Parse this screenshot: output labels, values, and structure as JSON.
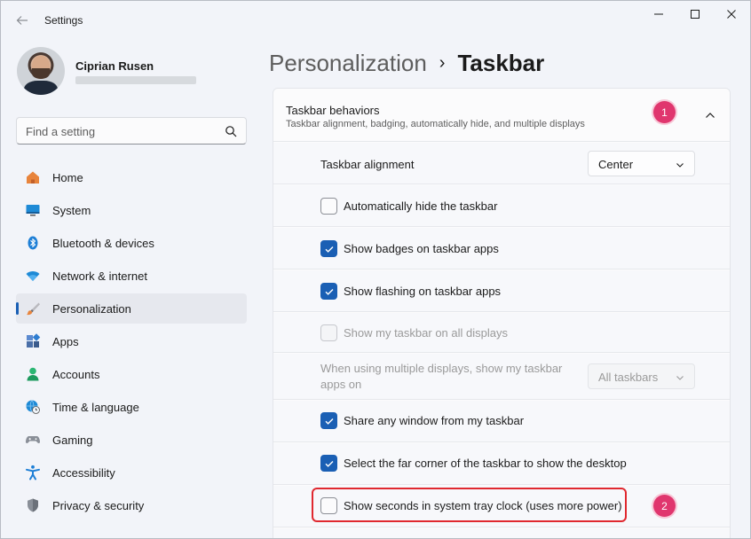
{
  "window": {
    "title": "Settings"
  },
  "user": {
    "name": "Ciprian Rusen"
  },
  "search": {
    "placeholder": "Find a setting"
  },
  "sidebar": {
    "items": [
      {
        "label": "Home",
        "icon": "home-icon",
        "active": false
      },
      {
        "label": "System",
        "icon": "system-icon",
        "active": false
      },
      {
        "label": "Bluetooth & devices",
        "icon": "bluetooth-icon",
        "active": false
      },
      {
        "label": "Network & internet",
        "icon": "wifi-icon",
        "active": false
      },
      {
        "label": "Personalization",
        "icon": "brush-icon",
        "active": true
      },
      {
        "label": "Apps",
        "icon": "apps-icon",
        "active": false
      },
      {
        "label": "Accounts",
        "icon": "account-icon",
        "active": false
      },
      {
        "label": "Time & language",
        "icon": "globe-clock-icon",
        "active": false
      },
      {
        "label": "Gaming",
        "icon": "gamepad-icon",
        "active": false
      },
      {
        "label": "Accessibility",
        "icon": "accessibility-icon",
        "active": false
      },
      {
        "label": "Privacy & security",
        "icon": "shield-icon",
        "active": false
      }
    ]
  },
  "breadcrumb": {
    "parent": "Personalization",
    "separator": "›",
    "current": "Taskbar"
  },
  "section": {
    "title": "Taskbar behaviors",
    "subtitle": "Taskbar alignment, badging, automatically hide, and multiple displays",
    "alignment_label": "Taskbar alignment",
    "alignment_value": "Center",
    "auto_hide": {
      "label": "Automatically hide the taskbar",
      "checked": false
    },
    "badges": {
      "label": "Show badges on taskbar apps",
      "checked": true
    },
    "flashing": {
      "label": "Show flashing on taskbar apps",
      "checked": true
    },
    "all_displays": {
      "label": "Show my taskbar on all displays",
      "checked": false,
      "disabled": true
    },
    "multi_display_label": "When using multiple displays, show my taskbar apps on",
    "multi_display_value": "All taskbars",
    "share_window": {
      "label": "Share any window from my taskbar",
      "checked": true
    },
    "far_corner": {
      "label": "Select the far corner of the taskbar to show the desktop",
      "checked": true
    },
    "show_seconds": {
      "label": "Show seconds in system tray clock (uses more power)",
      "checked": false
    }
  },
  "annotations": {
    "marker_1": "1",
    "marker_2": "2"
  },
  "colors": {
    "accent": "#1a5fb4",
    "annotation_marker": "#e0366e",
    "highlight_border": "#e0282f"
  }
}
